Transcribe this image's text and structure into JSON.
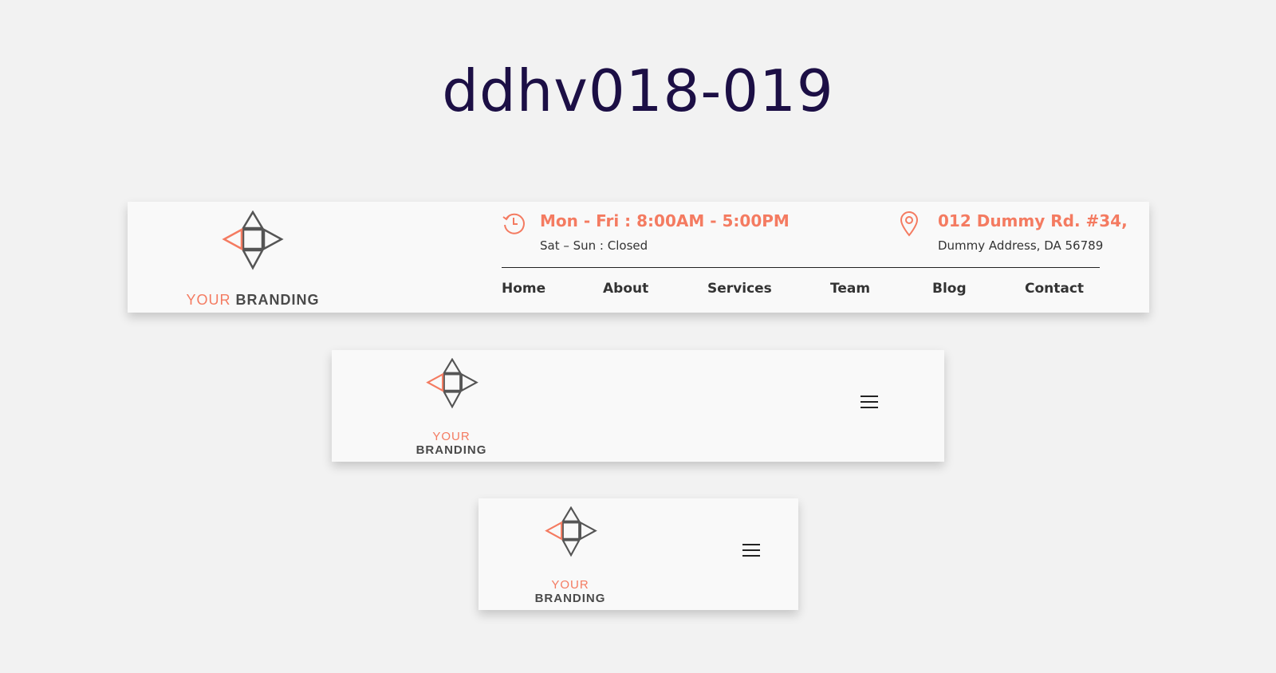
{
  "page": {
    "title": "ddhv018-019"
  },
  "colors": {
    "accent": "#f47b61",
    "dark": "#4a4a4a",
    "title": "#1c0f45",
    "card_bg": "#f9f9f9",
    "page_bg": "#f2f2f2"
  },
  "brand": {
    "part1": "YOUR",
    "part2": "BRANDING"
  },
  "header": {
    "hours": {
      "icon": "clock-history-icon",
      "line1": "Mon - Fri : 8:00AM - 5:00PM",
      "line2": "Sat – Sun : Closed"
    },
    "address": {
      "icon": "map-pin-icon",
      "line1": "012 Dummy Rd. #34,",
      "line2": "Dummy Address, DA 56789"
    },
    "nav": [
      "Home",
      "About",
      "Services",
      "Team",
      "Blog",
      "Contact"
    ]
  },
  "menu_icon": "hamburger-menu-icon"
}
